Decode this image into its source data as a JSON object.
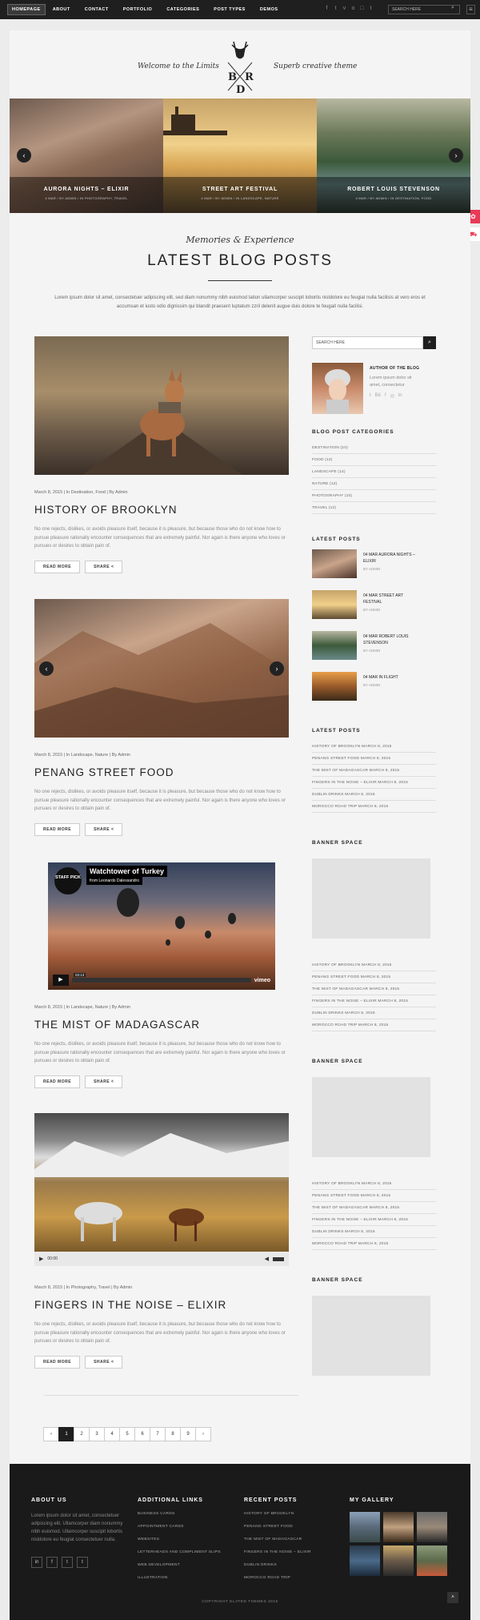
{
  "nav": [
    "HOMEPAGE",
    "ABOUT",
    "CONTACT",
    "PORTFOLIO",
    "CATEGORIES",
    "POST TYPES",
    "DEMOS"
  ],
  "nav_social": [
    "f",
    "t",
    "v",
    "o",
    "□",
    "t"
  ],
  "search": {
    "placeholder": "SEARCH HERE"
  },
  "header": {
    "left": "Welcome to the Limits",
    "right": "Superb creative theme",
    "logo_letters": "BRD"
  },
  "slider": [
    {
      "title": "AURORA NIGHTS – ELIXIR",
      "meta": "4 MAR / BY ADMIN / IN PHOTOGRAPHY, TRAVEL"
    },
    {
      "title": "STREET ART FESTIVAL",
      "meta": "4 MAR / BY ADMIN / IN LANDSCAPE, NATURE"
    },
    {
      "title": "ROBERT LOUIS STEVENSON",
      "meta": "4 MAR / BY ADMIN / IN DESTINATION, FOOD"
    }
  ],
  "intro": {
    "kicker": "Memories & Experience",
    "title": "LATEST BLOG POSTS",
    "text": "Lorem ipsum dolor sit amet, consectetuer adipiscing elit, sed diam nonummy nibh euismod tation ullamcorper suscipit lobortis nisldolore eu feugiat nulla facilisis at vero eros et accumsan et iusto odio dignissim qui blandit praesent luptatum zzril delenit augue duis dolore te feugait nulla facilisi."
  },
  "posts": [
    {
      "meta": "March 8, 2015 | In Destination, Food | By Admin",
      "title": "HISTORY OF BROOKLYN",
      "excerpt": "No one rejects, dislikes, or avoids pleasure itself, because it is pleasure, but because those who do not know how to pursue pleasure rationally encounter consequences that are extremely painful. Nor again is there anyone who loves or pursues or desires to obtain pain of.",
      "read": "READ MORE",
      "share": "SHARE"
    },
    {
      "meta": "March 8, 2015 | In Landscape, Nature | By Admin",
      "title": "PENANG STREET FOOD",
      "excerpt": "No one rejects, dislikes, or avoids pleasure itself, because it is pleasure, but because those who do not know how to pursue pleasure rationally encounter consequences that are extremely painful. Nor again is there anyone who loves or pursues or desires to obtain pain of.",
      "read": "READ MORE",
      "share": "SHARE"
    },
    {
      "meta": "March 8, 2015 | In Landscape, Nature | By Admin",
      "title": "THE MIST OF MADAGASCAR",
      "excerpt": "No one rejects, dislikes, or avoids pleasure itself, because it is pleasure, but because those who do not know how to pursue pleasure rationally encounter consequences that are extremely painful. Nor again is there anyone who loves or pursues or desires to obtain pain of.",
      "read": "READ MORE",
      "share": "SHARE"
    },
    {
      "meta": "March 8, 2015 | In Photography, Travel | By Admin",
      "title": "FINGERS IN THE NOISE – ELIXIR",
      "excerpt": "No one rejects, dislikes, or avoids pleasure itself, because it is pleasure, but because those who do not know how to pursue pleasure rationally encounter consequences that are extremely painful. Nor again is there anyone who loves or pursues or desires to obtain pain of.",
      "read": "READ MORE",
      "share": "SHARE"
    }
  ],
  "video": {
    "title": "Watchtower of Turkey",
    "from": "from Leonardo Dalessandro",
    "badge": "STAFF PICK",
    "time": "03:13",
    "brand": "vimeo"
  },
  "audio": {
    "time": "00:00"
  },
  "sidebar": {
    "search_placeholder": "SEARCH HERE",
    "author_title": "AUTHOR OF THE BLOG",
    "author_text": "Lorem ipsum dolor sit amet, consectetur",
    "cat_title": "BLOG POST CATEGORIES",
    "cats": [
      "DESTINATION (10)",
      "FOOD (12)",
      "LANDSCAPE (14)",
      "NATURE (12)",
      "PHOTOGRAPHY (10)",
      "TRAVEL (12)"
    ],
    "latest_title": "LATEST POSTS",
    "latest": [
      {
        "title": "04 MAR AURORA NIGHTS – ELIXIR",
        "by": "BY ADMIN"
      },
      {
        "title": "04 MAR STREET ART FESTIVAL",
        "by": "BY ADMIN"
      },
      {
        "title": "04 MAR ROBERT LOUIS STEVENSON",
        "by": "BY ADMIN"
      },
      {
        "title": "04 MAR IN FLIGHT",
        "by": "BY ADMIN"
      }
    ],
    "latest2_title": "LATEST POSTS",
    "list": [
      "HISTORY OF BROOKLYN MARCH 8, 2015",
      "PENANG STREET FOOD MARCH 8, 2015",
      "THE MIST OF MADAGASCAR MARCH 8, 2015",
      "FINGERS IN THE NOISE – ELIXIR MARCH 8, 2015",
      "DUBLIN DRINKS MARCH 8, 2015",
      "MOROCCO ROAD TRIP MARCH 8, 2015"
    ],
    "banner_title": "BANNER SPACE"
  },
  "pager": [
    "‹",
    "1",
    "2",
    "3",
    "4",
    "5",
    "6",
    "7",
    "8",
    "9",
    "›"
  ],
  "footer": {
    "about_title": "ABOUT US",
    "about_text": "Lorem ipsum dolor sit amet, consectetuer adipiscing elit. Ullamcorper diam nonummy nibh euismod. Ullamcorper suscipit lobortis nisldolore eu feugiat consectetuer nulla.",
    "links_title": "ADDITIONAL LINKS",
    "links": [
      "BUSINESS CARDS",
      "APPOINTMENT CARDS",
      "WEBSITES",
      "LETTERHEADS AND COMPLIMENT SLIPS",
      "WEB DEVELOPMENT",
      "ILLUSTRATION"
    ],
    "recent_title": "RECENT POSTS",
    "recent": [
      "HISTORY OF BROOKLYN",
      "PENANG STREET FOOD",
      "THE MIST OF MADAGASCAR",
      "FINGERS IN THE NOISE – ELIXIR",
      "DUBLIN DRINKS",
      "MOROCCO ROAD TRIP"
    ],
    "gallery_title": "MY GALLERY",
    "social": [
      "in",
      "f",
      "t",
      "t"
    ],
    "copyright": "COPYRIGHT ELATED THEMES 2015"
  },
  "colors": {
    "accent": "#e83a57",
    "dark": "#1f1f1f",
    "bg": "#ececec"
  }
}
